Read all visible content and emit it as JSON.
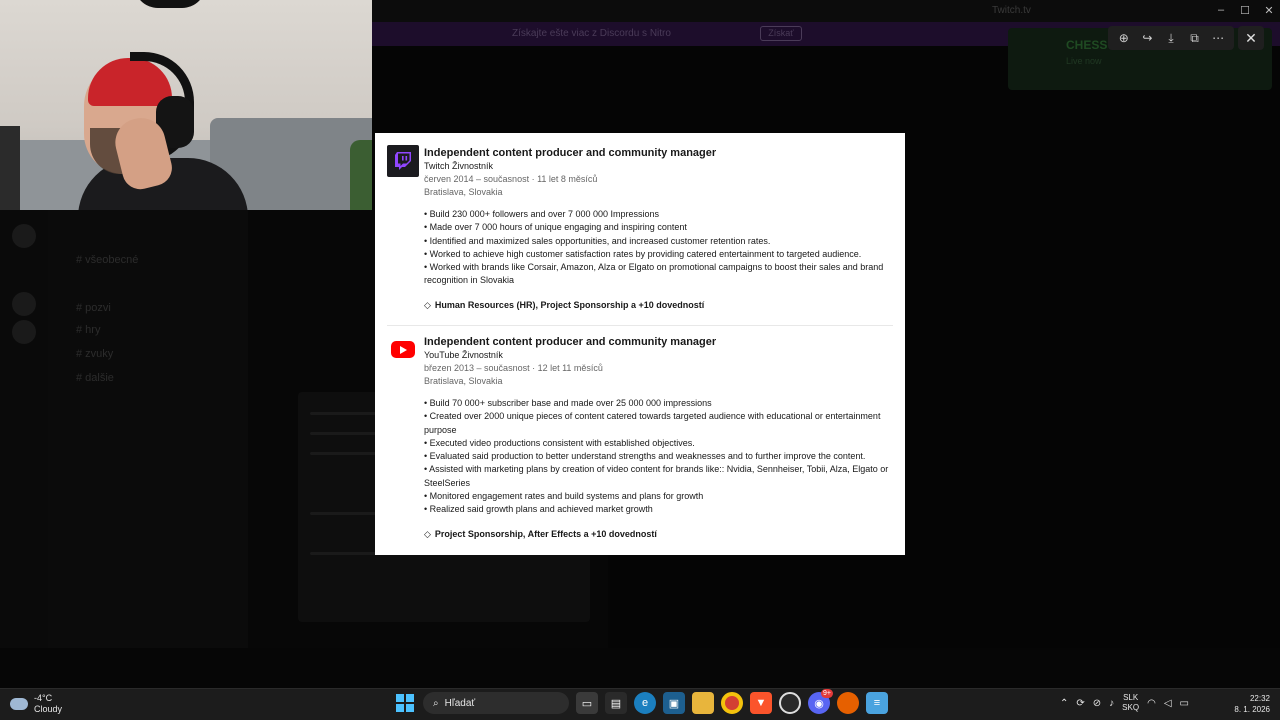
{
  "background_app": {
    "window_title": "Twitch.tv",
    "banner_text": "Získajte ešte viac z Discordu s Nitro",
    "banner_button": "Získať",
    "channels": [
      "# všeobecné",
      "# pozvi",
      "# hry",
      "# zvuky",
      "# dalšie"
    ],
    "notification_title": "CHESS",
    "notification_sub": "Live now"
  },
  "viewer_toolbar": {
    "zoom_icon": "zoom-in-icon",
    "share_icon": "share-icon",
    "download_icon": "download-icon",
    "open_icon": "open-external-icon",
    "more_icon": "more-icon",
    "close_icon": "close-icon"
  },
  "experience": [
    {
      "logo": "twitch-logo",
      "title": "Independent content producer and community manager",
      "company": "Twitch Živnostník",
      "dates": "červen 2014 – současnost · 11 let 8 měsíců",
      "location": "Bratislava, Slovakia",
      "bullets": [
        "• Build 230 000+ followers and over 7 000 000 Impressions",
        "• Made over 7 000 hours of unique engaging and inspiring content",
        "• Identified and maximized sales opportunities, and increased customer retention rates.",
        "• Worked to achieve high customer satisfaction rates by providing catered entertainment to targeted audience.",
        "• Worked with brands like Corsair, Amazon, Alza or Elgato on promotional campaigns to boost their sales and brand recognition in Slovakia"
      ],
      "skills": "Human Resources (HR), Project Sponsorship a +10 dovedností"
    },
    {
      "logo": "youtube-logo",
      "title": "Independent content producer and community manager",
      "company": "YouTube Živnostník",
      "dates": "březen 2013 – současnost · 12 let 11 měsíců",
      "location": "Bratislava, Slovakia",
      "bullets": [
        "• Build 70 000+ subscriber base and made over 25 000 000 impressions",
        "• Created over 2000 unique pieces of content catered towards targeted audience with educational or entertainment purpose",
        "• Executed video productions consistent with established objectives.",
        "• Evaluated said production to better understand strengths and weaknesses and to further improve the content.",
        "• Assisted with marketing plans by creation of video content for brands like:: Nvidia, Sennheiser, Tobii, Alza, Elgato or SteelSeries",
        "• Monitored engagement rates and build systems and plans for growth",
        "• Realized said growth plans and achieved market growth"
      ],
      "skills": "Project Sponsorship, After Effects a +10 dovedností"
    }
  ],
  "taskbar": {
    "temperature": "-4°C",
    "weather": "Cloudy",
    "search_placeholder": "Hľadať",
    "apps": [
      "file-explorer",
      "store",
      "edge",
      "photos",
      "folder",
      "chrome",
      "brave",
      "obs",
      "discord",
      "firefox",
      "notepad"
    ],
    "discord_badge": "9+",
    "lang_top": "SLK",
    "lang_bottom": "SKQ",
    "time": "22:32",
    "date": "8. 1. 2026"
  },
  "colors": {
    "twitch": "#9146ff",
    "youtube": "#ff0000",
    "accent": "#4cc2ff"
  }
}
